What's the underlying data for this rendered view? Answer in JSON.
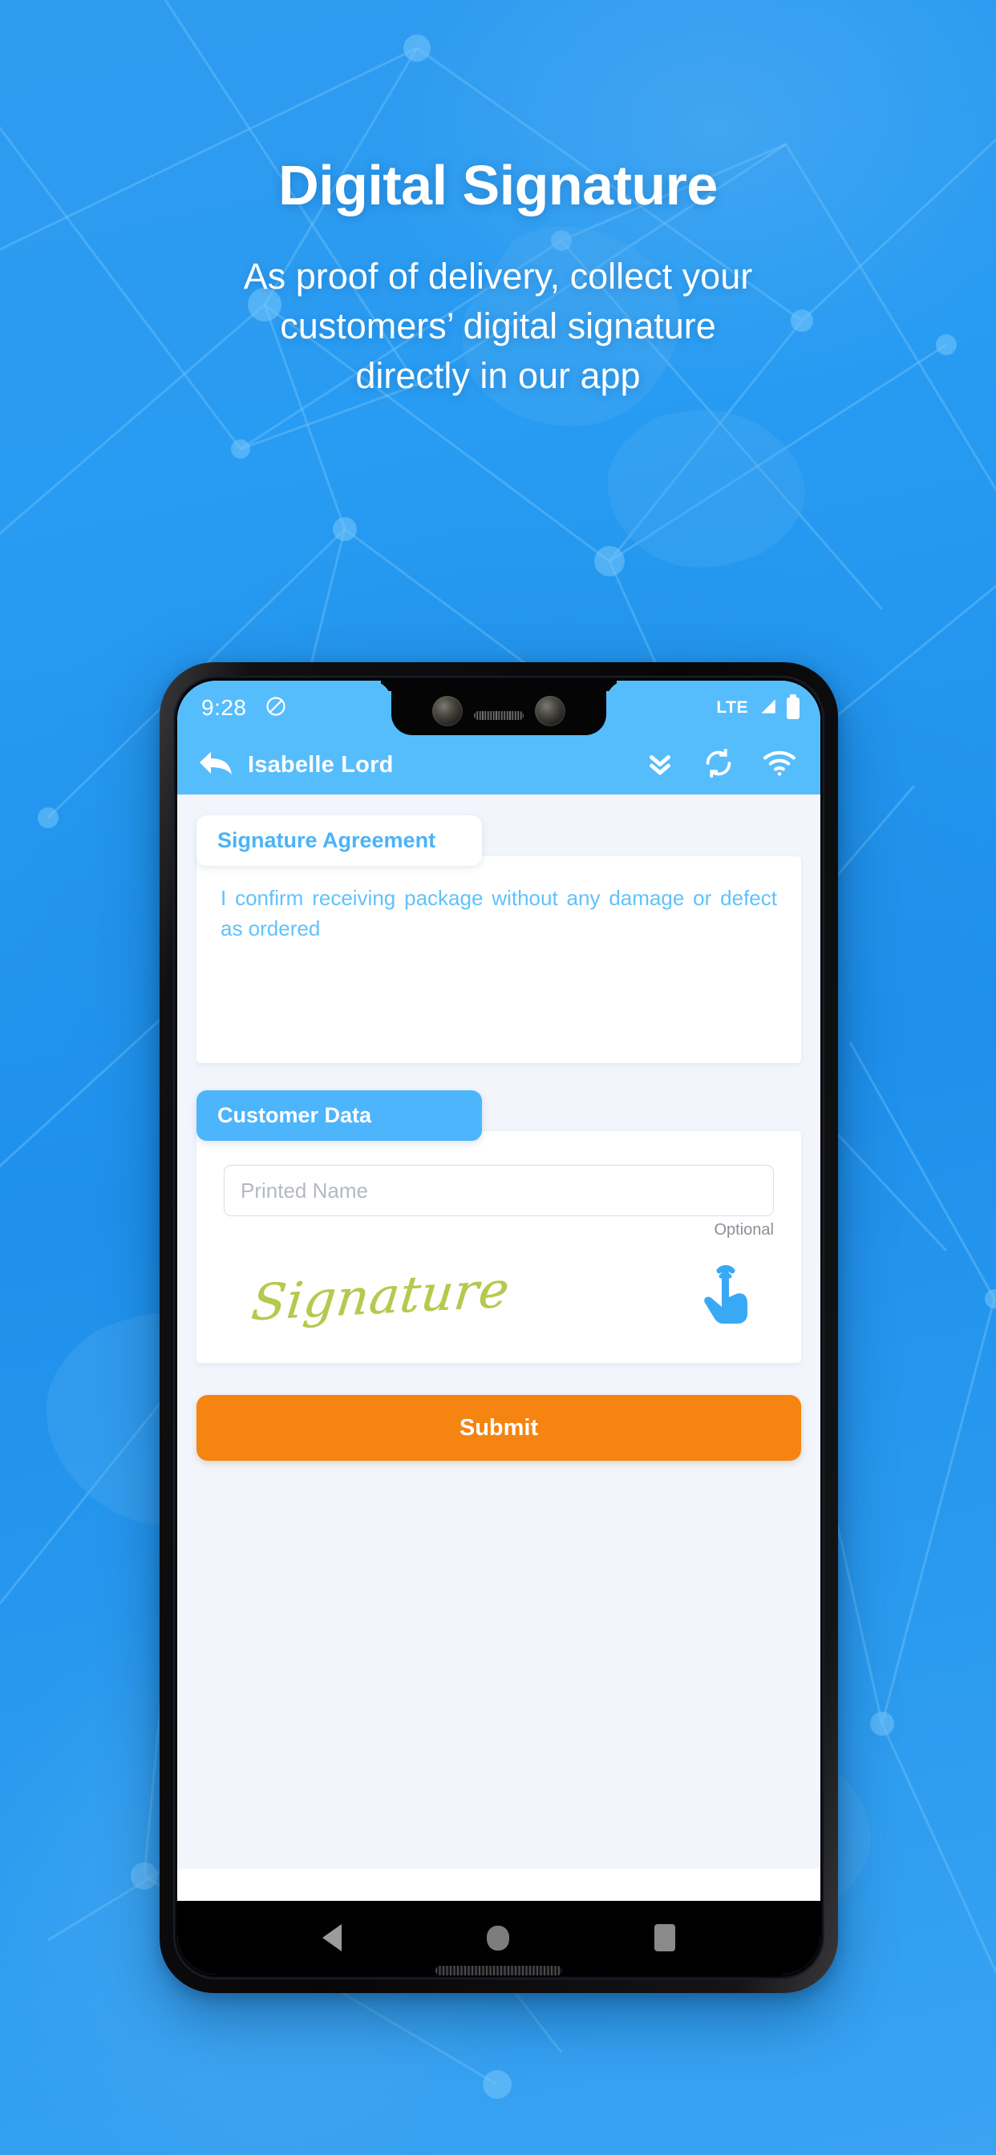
{
  "promo": {
    "title": "Digital Signature",
    "subtitle_lines": [
      "As proof of delivery, collect your",
      "customers’ digital signature",
      "directly in our app"
    ],
    "background_color": "#2196f3",
    "title_color": "#ffffff"
  },
  "phone": {
    "status_bar": {
      "time": "9:28",
      "dnd_icon": "do-not-disturb-icon",
      "network": "LTE",
      "signal_icon": "signal-bars-icon",
      "battery_icon": "battery-full-icon",
      "background_color": "#56bdfd"
    },
    "app_bar": {
      "back_icon": "back-arrow-icon",
      "title": "Isabelle Lord",
      "actions": [
        {
          "icon": "double-chevron-down-icon",
          "name": "collapse-all-button"
        },
        {
          "icon": "sync-refresh-icon",
          "name": "sync-button"
        },
        {
          "icon": "wifi-icon",
          "name": "wifi-status-icon"
        }
      ],
      "background_color": "#56bdfd"
    },
    "screen": {
      "background_color": "#F2F5FC",
      "agreement": {
        "header": "Signature Agreement",
        "header_text_color": "#4bb3f7",
        "body": "I confirm receiving package without any damage or defect as ordered",
        "body_text_color": "#61c2fb"
      },
      "customer": {
        "header": "Customer Data",
        "header_bg_color": "#4db5fb",
        "printed_name_value": "",
        "printed_name_placeholder": "Printed Name",
        "optional_label": "Optional",
        "signature_word": "Signature",
        "signature_color": "#b7c84e",
        "tap_icon": "tap-hand-icon",
        "tap_icon_color": "#3aa9f5"
      },
      "submit": {
        "label": "Submit",
        "color": "#F58410"
      }
    },
    "nav_bar": {
      "back": "nav-back-triangle",
      "home": "nav-home-circle",
      "recents": "nav-recents-square",
      "background_color": "#000000"
    }
  }
}
